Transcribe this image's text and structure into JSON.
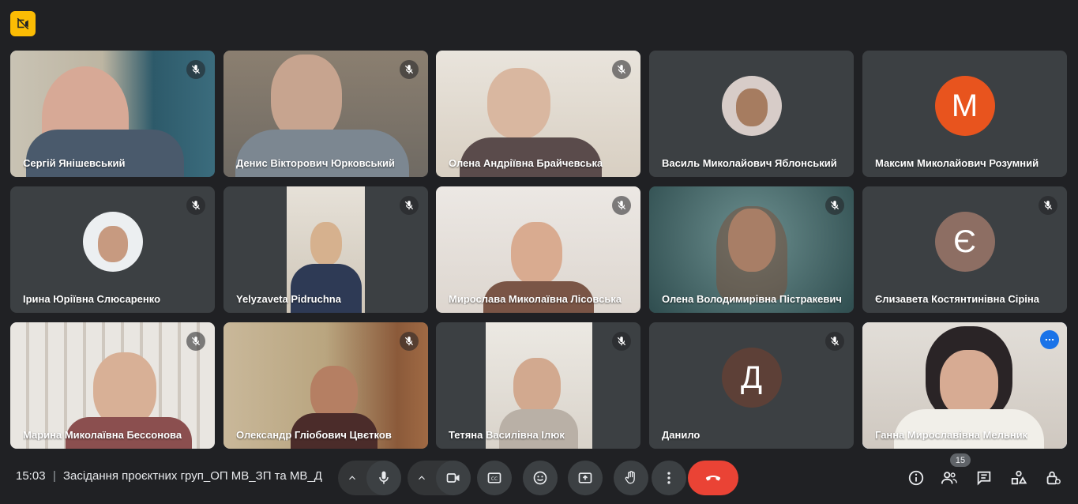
{
  "meeting": {
    "time": "15:03",
    "separator": "|",
    "title": "Засідання проєктних груп_ОП МВ_ЗП та МВ_Д",
    "participant_count": "15"
  },
  "colors": {
    "accent": "#8ab4f8",
    "end_call": "#ea4335",
    "warning": "#fbbc04",
    "avatar_m": "#e8541e",
    "avatar_ye": "#8d6e63",
    "avatar_d": "#5d4037"
  },
  "participants": [
    {
      "name": "Сергій Янішевський",
      "kind": "video",
      "muted": true
    },
    {
      "name": "Денис Вікторович Юрковський",
      "kind": "video",
      "muted": true
    },
    {
      "name": "Олена Андріївна Брайчевська",
      "kind": "video",
      "muted": true
    },
    {
      "name": "Василь Миколайович Яблонський",
      "kind": "photo",
      "muted": false
    },
    {
      "name": "Максим Миколайович Розумний",
      "kind": "letter",
      "letter": "M",
      "muted": false
    },
    {
      "name": "Ірина Юріївна Слюсаренко",
      "kind": "photo",
      "muted": true
    },
    {
      "name": "Yelyzaveta Pidruchna",
      "kind": "video",
      "muted": true
    },
    {
      "name": "Мирослава Миколаївна Лісовська",
      "kind": "video",
      "muted": true
    },
    {
      "name": "Олена Володимирівна Пістракевич",
      "kind": "video",
      "muted": true
    },
    {
      "name": "Єлизавета Костянтинівна Сіріна",
      "kind": "letter",
      "letter": "Є",
      "muted": true
    },
    {
      "name": "Марина Миколаївна Бессонова",
      "kind": "video",
      "muted": true
    },
    {
      "name": "Олександр Гліобович Цвєтков",
      "kind": "video",
      "muted": true
    },
    {
      "name": "Тетяна Василівна Ілюк",
      "kind": "video",
      "muted": true
    },
    {
      "name": "Данило",
      "kind": "letter",
      "letter": "Д",
      "muted": true
    },
    {
      "name": "Ганна Мирославівна Мельник",
      "kind": "video",
      "muted": false,
      "active": true
    }
  ]
}
